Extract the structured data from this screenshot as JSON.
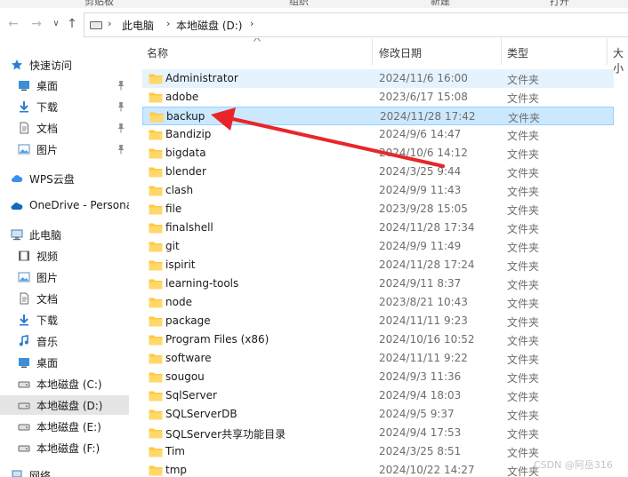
{
  "ribbon": [
    "剪贴板",
    "组织",
    "新建",
    "打开"
  ],
  "address": {
    "breadcrumbs": [
      "此电脑",
      "本地磁盘 (D:)"
    ],
    "icon": "drive-icon"
  },
  "nav": {
    "items": [
      {
        "label": "快速访问",
        "icon": "star-icon",
        "level": 0,
        "pinned": false,
        "selected": false
      },
      {
        "label": "桌面",
        "icon": "desktop-icon",
        "level": 1,
        "pinned": true,
        "selected": false
      },
      {
        "label": "下载",
        "icon": "download-icon",
        "level": 1,
        "pinned": true,
        "selected": false
      },
      {
        "label": "文档",
        "icon": "document-icon",
        "level": 1,
        "pinned": true,
        "selected": false
      },
      {
        "label": "图片",
        "icon": "picture-icon",
        "level": 1,
        "pinned": true,
        "selected": false
      },
      {
        "label": "WPS云盘",
        "icon": "cloud-icon",
        "level": 0,
        "pinned": false,
        "selected": false
      },
      {
        "label": "OneDrive - Persona",
        "icon": "onedrive-icon",
        "level": 0,
        "pinned": false,
        "selected": false
      },
      {
        "label": "此电脑",
        "icon": "computer-icon",
        "level": 0,
        "pinned": false,
        "selected": false
      },
      {
        "label": "视频",
        "icon": "video-icon",
        "level": 1,
        "pinned": false,
        "selected": false
      },
      {
        "label": "图片",
        "icon": "picture-icon",
        "level": 1,
        "pinned": false,
        "selected": false
      },
      {
        "label": "文档",
        "icon": "document-icon",
        "level": 1,
        "pinned": false,
        "selected": false
      },
      {
        "label": "下载",
        "icon": "download-icon",
        "level": 1,
        "pinned": false,
        "selected": false
      },
      {
        "label": "音乐",
        "icon": "music-icon",
        "level": 1,
        "pinned": false,
        "selected": false
      },
      {
        "label": "桌面",
        "icon": "desktop-icon",
        "level": 1,
        "pinned": false,
        "selected": false
      },
      {
        "label": "本地磁盘 (C:)",
        "icon": "drive-icon",
        "level": 1,
        "pinned": false,
        "selected": false
      },
      {
        "label": "本地磁盘 (D:)",
        "icon": "drive-icon",
        "level": 1,
        "pinned": false,
        "selected": true
      },
      {
        "label": "本地磁盘 (E:)",
        "icon": "drive-icon",
        "level": 1,
        "pinned": false,
        "selected": false
      },
      {
        "label": "本地磁盘 (F:)",
        "icon": "drive-icon",
        "level": 1,
        "pinned": false,
        "selected": false
      },
      {
        "label": "网络",
        "icon": "network-icon",
        "level": 0,
        "pinned": false,
        "selected": false
      }
    ]
  },
  "columns": {
    "name": "名称",
    "date": "修改日期",
    "type": "类型",
    "size": "大小"
  },
  "files": [
    {
      "name": "Administrator",
      "date": "2024/11/6 16:00",
      "type": "文件夹",
      "state": "hover"
    },
    {
      "name": "adobe",
      "date": "2023/6/17 15:08",
      "type": "文件夹",
      "state": ""
    },
    {
      "name": "backup",
      "date": "2024/11/28 17:42",
      "type": "文件夹",
      "state": "sel"
    },
    {
      "name": "Bandizip",
      "date": "2024/9/6 14:47",
      "type": "文件夹",
      "state": ""
    },
    {
      "name": "bigdata",
      "date": "2024/10/6 14:12",
      "type": "文件夹",
      "state": ""
    },
    {
      "name": "blender",
      "date": "2024/3/25 9:44",
      "type": "文件夹",
      "state": ""
    },
    {
      "name": "clash",
      "date": "2024/9/9 11:43",
      "type": "文件夹",
      "state": ""
    },
    {
      "name": "file",
      "date": "2023/9/28 15:05",
      "type": "文件夹",
      "state": ""
    },
    {
      "name": "finalshell",
      "date": "2024/11/28 17:34",
      "type": "文件夹",
      "state": ""
    },
    {
      "name": "git",
      "date": "2024/9/9 11:49",
      "type": "文件夹",
      "state": ""
    },
    {
      "name": "ispirit",
      "date": "2024/11/28 17:24",
      "type": "文件夹",
      "state": ""
    },
    {
      "name": "learning-tools",
      "date": "2024/9/11 8:37",
      "type": "文件夹",
      "state": ""
    },
    {
      "name": "node",
      "date": "2023/8/21 10:43",
      "type": "文件夹",
      "state": ""
    },
    {
      "name": "package",
      "date": "2024/11/11 9:23",
      "type": "文件夹",
      "state": ""
    },
    {
      "name": "Program Files (x86)",
      "date": "2024/10/16 10:52",
      "type": "文件夹",
      "state": ""
    },
    {
      "name": "software",
      "date": "2024/11/11 9:22",
      "type": "文件夹",
      "state": ""
    },
    {
      "name": "sougou",
      "date": "2024/9/3 11:36",
      "type": "文件夹",
      "state": ""
    },
    {
      "name": "SqlServer",
      "date": "2024/9/4 18:03",
      "type": "文件夹",
      "state": ""
    },
    {
      "name": "SQLServerDB",
      "date": "2024/9/5 9:37",
      "type": "文件夹",
      "state": ""
    },
    {
      "name": "SQLServer共享功能目录",
      "date": "2024/9/4 17:53",
      "type": "文件夹",
      "state": ""
    },
    {
      "name": "Tim",
      "date": "2024/3/25 8:51",
      "type": "文件夹",
      "state": ""
    },
    {
      "name": "tmp",
      "date": "2024/10/22 14:27",
      "type": "文件夹",
      "state": ""
    }
  ],
  "watermark": "CSDN @阿岳316",
  "colors": {
    "selection": "#cce8ff",
    "hover": "#e5f3ff",
    "annotation_arrow": "#e8262a",
    "folder": "#ffc83d"
  }
}
